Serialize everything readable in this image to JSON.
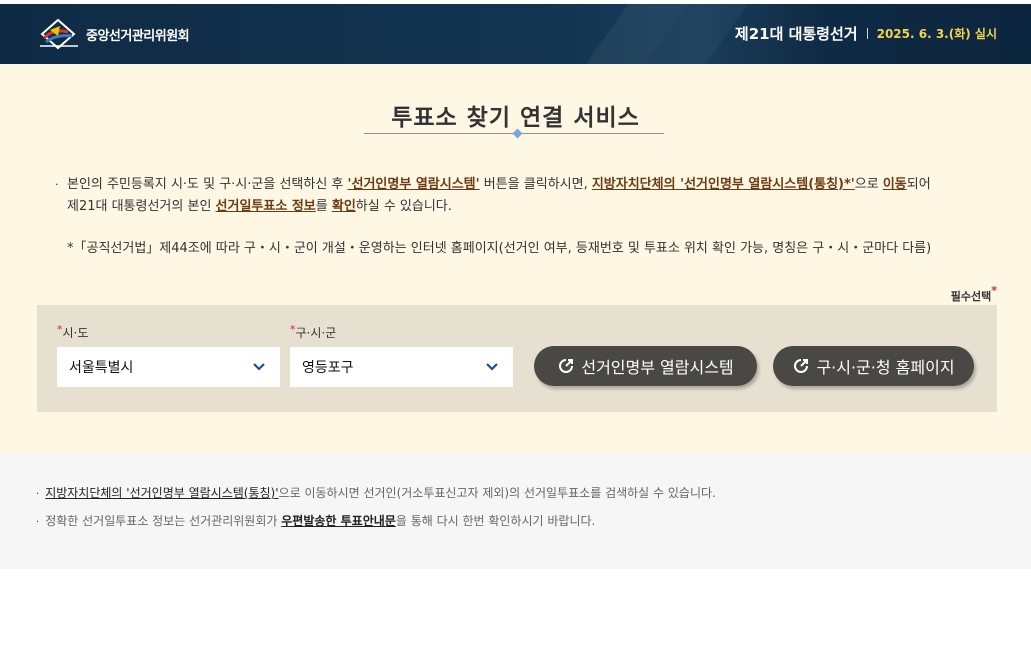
{
  "header": {
    "org_name": "중앙선거관리위원회",
    "election_name": "제21대 대통령선거",
    "election_date": "2025. 6. 3.(화) 실시"
  },
  "page": {
    "title": "투표소 찾기 연결 서비스"
  },
  "description": {
    "bullet": "·",
    "part1": "본인의 주민등록지 시·도 및 구·시·군을 선택하신 후 ",
    "link1": "'선거인명부 열람시스템'",
    "part2": " 버튼을 클릭하시면, ",
    "link2": "지방자치단체의 '선거인명부 열람시스템(통칭)*'",
    "part3": "으로 ",
    "link3": "이동",
    "part4": "되어",
    "part5": "제21대 대통령선거의 본인 ",
    "link4": "선거일투표소 정보",
    "part6": "를 ",
    "link5": "확인",
    "part7": "하실 수 있습니다.",
    "note": "*「공직선거법」제44조에 따라 구・시・군이 개설・운영하는 인터넷 홈페이지(선거인 여부, 등재번호 및 투표소 위치 확인 가능, 명칭은 구・시・군마다 다름)"
  },
  "form": {
    "required_label": "필수선택",
    "required_mark": "*",
    "sido_label": "시·도",
    "sido_value": "서울특별시",
    "sigungu_label": "구·시·군",
    "sigungu_value": "영등포구",
    "btn_registry": "선거인명부 열람시스템",
    "btn_homepage": "구·시·군·청 홈페이지"
  },
  "footer": {
    "bullet": "·",
    "line1_link": "지방자치단체의 '선거인명부 열람시스템(통칭)'",
    "line1_rest": "으로 이동하시면 선거인(거소투표신고자 제외)의 선거일투표소를 검색하실 수 있습니다.",
    "line2_pre": "정확한 선거일투표소 정보는 선거관리위원회가 ",
    "line2_link": "우편발송한 투표안내문",
    "line2_rest": "을 통해 다시 한번 확인하시기 바랍니다."
  },
  "colors": {
    "header_bg": "#0f2a44",
    "accent_date": "#f2d34a",
    "content_bg": "#fdf7e4",
    "panel_bg": "#e6e0d0",
    "button_bg": "#4a4845",
    "required": "#e0202a",
    "link_brown": "#6b3c12"
  },
  "icons": [
    "nec-logo-icon",
    "chevron-down-icon",
    "external-link-icon"
  ]
}
